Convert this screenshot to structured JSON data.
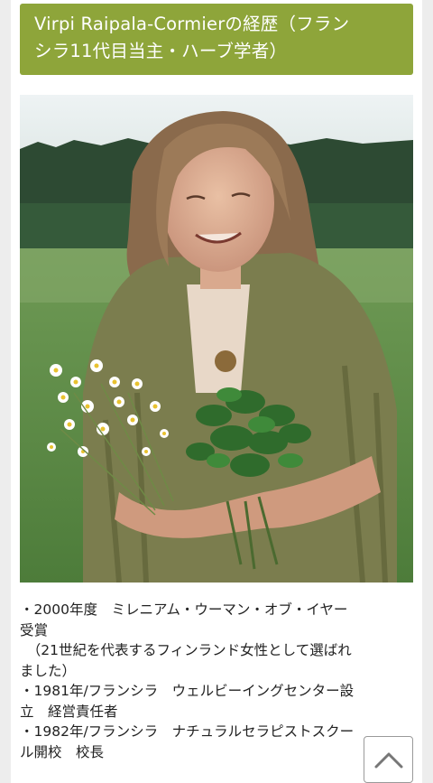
{
  "header": {
    "title_line1": "Virpi Raipala-Cormierの経歴（フラン",
    "title_line2": "シラ11代目当主・ハーブ学者）"
  },
  "photo": {
    "icon": "portrait-photo"
  },
  "bio": {
    "lines": [
      "・2000年度　ミレニアム・ウーマン・オブ・イヤー",
      "受賞",
      "　（21世紀を代表するフィンランド女性として選ばれ",
      "ました）",
      "・1981年/フランシラ　ウェルビーイングセンター設",
      "立　経営責任者",
      "・1982年/フランシラ　ナチュラルセラピストスクー",
      "ル開校　校長"
    ]
  },
  "scroll_top": {
    "icon": "chevron-up-icon"
  },
  "colors": {
    "header_bg": "#8ea53a",
    "page_bg": "#ededed",
    "text": "#222222"
  }
}
